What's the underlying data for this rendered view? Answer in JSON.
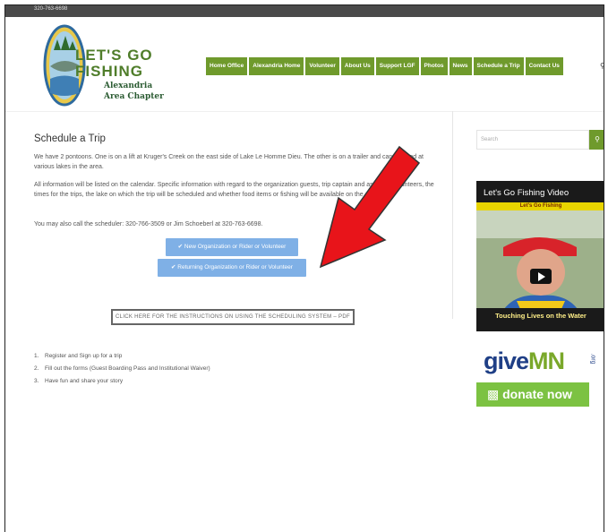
{
  "topbar": {
    "phone": "320-763-6698"
  },
  "logo": {
    "line1": "LET'S GO",
    "line2": "FISHING",
    "sub1": "Alexandria",
    "sub2": "Area Chapter"
  },
  "nav": {
    "items": [
      "Home Office",
      "Alexandria Home",
      "Volunteer",
      "About Us",
      "Support LGF",
      "Photos",
      "News",
      "Schedule a Trip",
      "Contact Us"
    ],
    "search_icon": "search-icon"
  },
  "main": {
    "title": "Schedule a Trip",
    "para1": "We have 2 pontoons. One is on a lift at Kruger's Creek on the east side of Lake Le Homme Dieu. The other is on a trailer and can be used at various lakes in the area.",
    "para2": "All information will be listed on the calendar. Specific information with regard to the organization guests, trip captain and assistant volunteers, the times for the trips, the lake on which the trip will be scheduled and whether food items or fishing will be available on the calendar.",
    "para3": "You may also call the scheduler: 320-766-3509 or Jim Schoeberl at 320-763-6698.",
    "btn_new": "✔ New Organization or Rider or Volunteer",
    "btn_returning": "✔ Returning Organization or Rider or Volunteer",
    "pdf_link": "CLICK HERE FOR THE INSTRUCTIONS ON USING THE SCHEDULING SYSTEM – PDF",
    "steps": [
      {
        "num": "1.",
        "text": "Register and Sign up for a trip"
      },
      {
        "num": "2.",
        "text": "Fill out the forms (Guest Boarding Pass and Institutional Waiver)"
      },
      {
        "num": "3.",
        "text": "Have fun and share your story"
      }
    ]
  },
  "sidebar": {
    "search_placeholder": "Search",
    "video_title": "Let's Go Fishing Video",
    "video_banner": "Let's Go Fishing",
    "video_caption": "Touching Lives on the Water",
    "give_part1": "give",
    "give_part2": "MN",
    "give_org": ".org",
    "donate_label": "donate now",
    "donate_icon": "donate-icon"
  },
  "colors": {
    "nav_green": "#6f9a2c",
    "button_blue": "#7fb0e6",
    "arrow_red": "#e8141a",
    "donate_green": "#7cc242"
  }
}
